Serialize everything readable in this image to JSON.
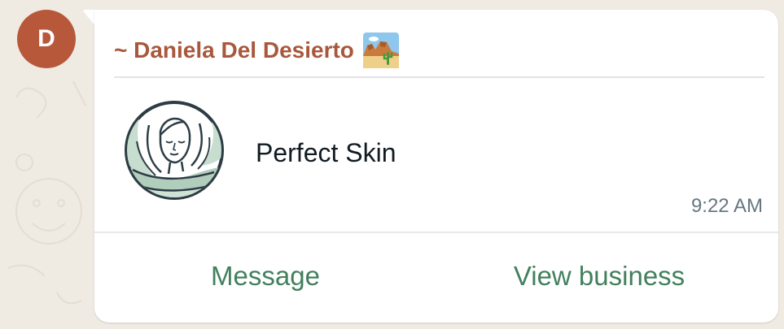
{
  "chat": {
    "avatar_letter": "D",
    "sender_name": "~ Daniela Del Desierto",
    "sender_emoji": "desert-emoji",
    "business_name": "Perfect Skin",
    "business_logo": "woman-face-logo",
    "time": "9:22 AM",
    "actions": {
      "message_label": "Message",
      "view_business_label": "View business"
    }
  },
  "colors": {
    "avatar": "#b8583a",
    "sender_name": "#a8583c",
    "action_text": "#42805d",
    "timestamp": "#667781",
    "wallpaper": "#efeae2"
  }
}
